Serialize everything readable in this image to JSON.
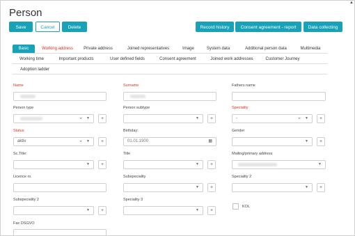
{
  "title": "Person",
  "toolbar": {
    "save": "Save",
    "cancel": "Cancel",
    "delete": "Delete",
    "record_history": "Record history",
    "consent_report": "Consent agreement - report",
    "data_collecting": "Data collecting"
  },
  "tabs_row1": [
    "Basic",
    "Working address",
    "Private address",
    "Joined representatives",
    "Image",
    "System data",
    "Additional person data",
    "Multimedia"
  ],
  "tabs_row2": [
    "Working time",
    "Important products",
    "User defined fields",
    "Consent agreement",
    "Joined work addresses",
    "Customer Journey"
  ],
  "tabs_row3": [
    "Adoption ladder"
  ],
  "form": {
    "name_label": "Name",
    "surname_label": "Surname",
    "fathers_name_label": "Fathers name",
    "person_type_label": "Person type",
    "person_subtype_label": "Person subtype",
    "speciality_label": "Speciality",
    "speciality_value": "-",
    "status_label": "Status",
    "status_value": "aktiv",
    "birthday_label": "Birthday:",
    "birthday_placeholder": "01.01.1900",
    "gender_label": "Gender",
    "sc_title_label": "Sc.Title:",
    "title_label": "Title",
    "mailing_label": "Mailing/primary address",
    "licence_label": "Licence nr.",
    "subspeciality_label": "Subspeciality",
    "speciality2_label": "Speciality 2",
    "subspeciality2_label": "Subspeciality 2",
    "speciality3_label": "Speciality 3",
    "kol_label": "KOL",
    "fax_label": "Fax DSGVO"
  },
  "icons": {
    "clear": "×",
    "caret": "▼",
    "plus": "+",
    "calendar": "▦",
    "scroll_up": "▲"
  },
  "colors": {
    "accent": "#17a2b8",
    "required": "#e0301e"
  }
}
